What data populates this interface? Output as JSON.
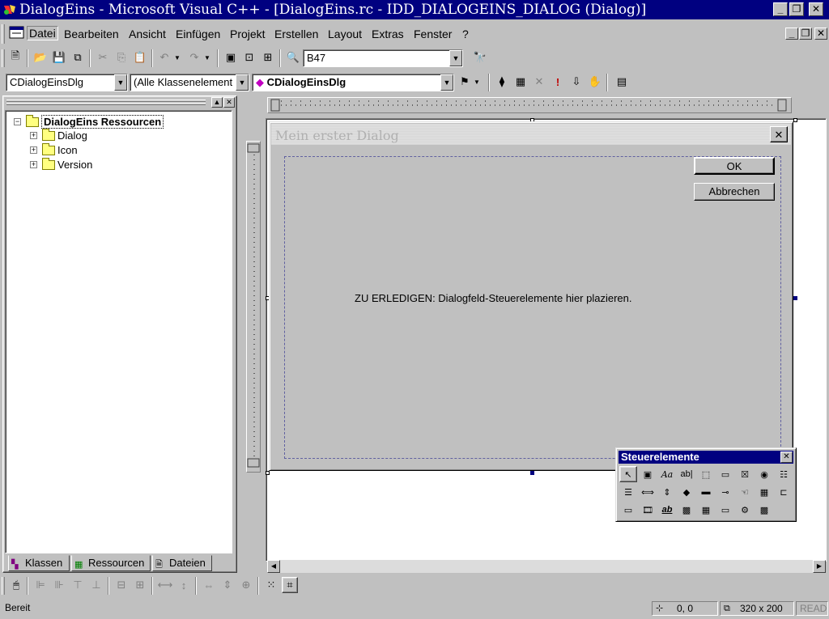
{
  "window": {
    "title": "DialogEins - Microsoft Visual C++ - [DialogEins.rc - IDD_DIALOGEINS_DIALOG (Dialog)]"
  },
  "menu": {
    "items": [
      "Datei",
      "Bearbeiten",
      "Ansicht",
      "Einfügen",
      "Projekt",
      "Erstellen",
      "Layout",
      "Extras",
      "Fenster",
      "?"
    ]
  },
  "toolbar": {
    "find_value": "B47",
    "class_combo": "CDialogEinsDlg",
    "filter_combo": "(Alle Klassenelement",
    "member_combo": "CDialogEinsDlg"
  },
  "workspace": {
    "root_label": "DialogEins Ressourcen",
    "items": [
      "Dialog",
      "Icon",
      "Version"
    ],
    "tabs": [
      "Klassen",
      "Ressourcen",
      "Dateien"
    ]
  },
  "dialog": {
    "title": "Mein erster Dialog",
    "close_glyph": "✕",
    "ok_label": "OK",
    "cancel_label": "Abbrechen",
    "todo_text": "ZU ERLEDIGEN: Dialogfeld-Steuerelemente hier plazieren."
  },
  "toolbox": {
    "title": "Steuerelemente",
    "tools_row1": [
      "↖",
      "▣",
      "Aa",
      "ab|",
      "⬚",
      "▭",
      "☒",
      "◉",
      "☷"
    ],
    "tools_row2": [
      "☰",
      "⟺",
      "⇕",
      "◆",
      "▬",
      "⊸",
      "☜",
      "▦",
      "⊏"
    ],
    "tools_row3": [
      "▭",
      "🎞",
      "ab",
      "▩",
      "▦",
      "▭",
      "⚙",
      "▩"
    ]
  },
  "status": {
    "text": "Bereit",
    "position": "0, 0",
    "size": "320 x 200",
    "mode": "READ"
  },
  "colors": {
    "titlebar": "#000080",
    "face": "#c0c0c0",
    "toolbox_caption": "#000080"
  }
}
